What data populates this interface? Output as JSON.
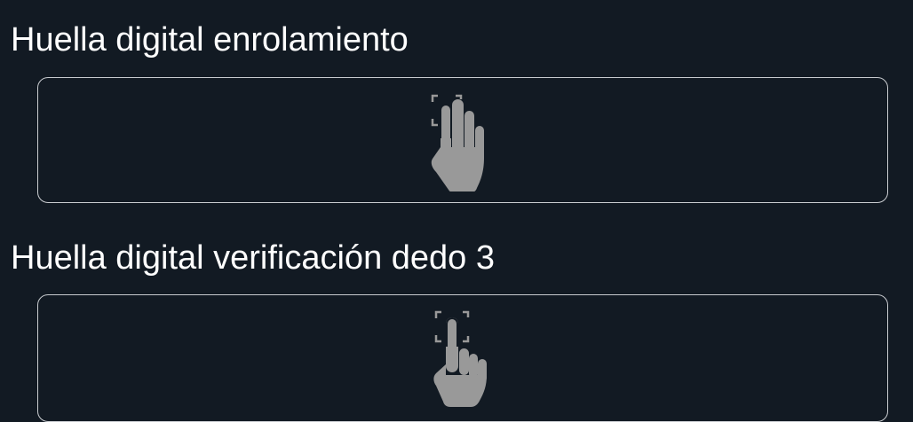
{
  "fingerprint_sections": [
    {
      "title": "Huella digital enrolamiento",
      "icon": "multi-finger-touch-icon",
      "icon_color": "#999999"
    },
    {
      "title": "Huella digital verificación dedo 3",
      "icon": "single-finger-touch-icon",
      "icon_color": "#999999"
    }
  ],
  "colors": {
    "background": "#121a23",
    "text": "#ffffff",
    "border": "#c9ccd0"
  }
}
